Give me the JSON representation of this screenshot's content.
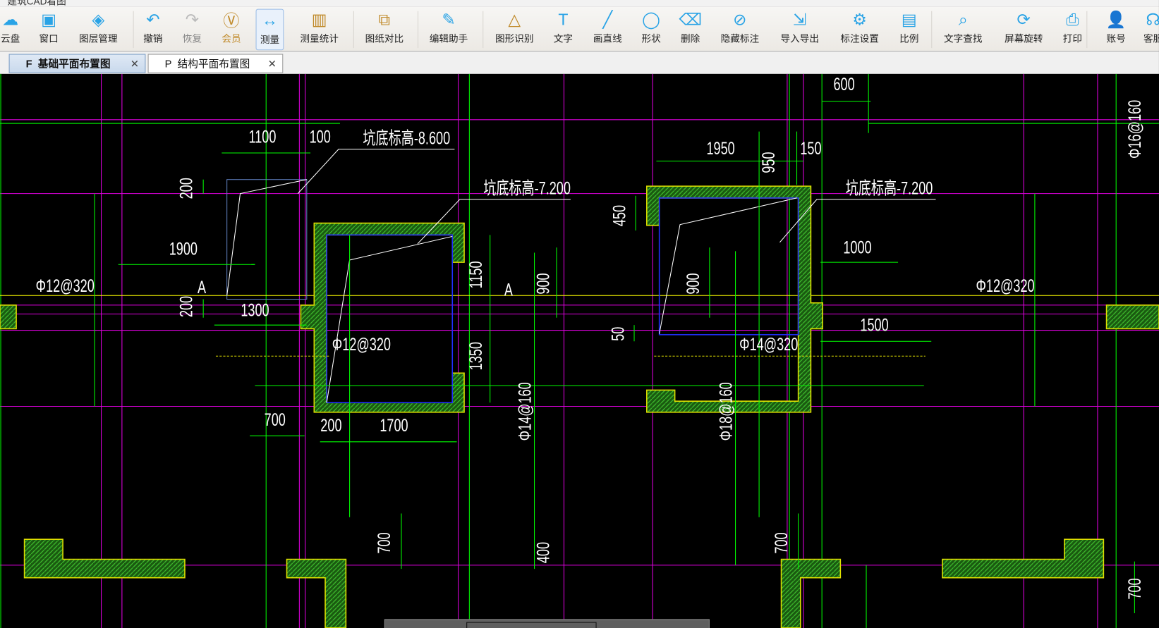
{
  "title": "建筑CAD看图",
  "toolbar": {
    "items": [
      {
        "label": "云盘",
        "icon": "cloud-icon"
      },
      {
        "label": "窗口",
        "icon": "window-icon"
      },
      {
        "label": "图层管理",
        "icon": "layers-icon"
      },
      {
        "label": "撤销",
        "icon": "undo-icon"
      },
      {
        "label": "恢复",
        "icon": "redo-icon"
      },
      {
        "label": "会员",
        "icon": "vip-icon"
      },
      {
        "label": "测量",
        "icon": "measure-icon"
      },
      {
        "label": "测量统计",
        "icon": "measure-stats-icon"
      },
      {
        "label": "图纸对比",
        "icon": "compare-icon"
      },
      {
        "label": "编辑助手",
        "icon": "cad-edit-icon"
      },
      {
        "label": "图形识别",
        "icon": "shape-recognize-icon"
      },
      {
        "label": "文字",
        "icon": "text-icon"
      },
      {
        "label": "画直线",
        "icon": "line-icon"
      },
      {
        "label": "形状",
        "icon": "shape-icon"
      },
      {
        "label": "删除",
        "icon": "eraser-icon"
      },
      {
        "label": "隐藏标注",
        "icon": "hide-icon"
      },
      {
        "label": "导入导出",
        "icon": "import-export-icon"
      },
      {
        "label": "标注设置",
        "icon": "annotation-settings-icon"
      },
      {
        "label": "比例",
        "icon": "scale-icon"
      },
      {
        "label": "文字查找",
        "icon": "text-search-icon"
      },
      {
        "label": "屏幕旋转",
        "icon": "rotate-icon"
      },
      {
        "label": "打印",
        "icon": "print-icon"
      },
      {
        "label": "账号",
        "icon": "account-icon"
      },
      {
        "label": "客服",
        "icon": "support-icon"
      }
    ],
    "active": "测量"
  },
  "tabs": [
    {
      "prefix": "F",
      "label": "基础平面布置图",
      "active": true
    },
    {
      "prefix": "P",
      "label": "结构平面布置图",
      "active": false
    }
  ],
  "colors": {
    "magenta": "#e000e0",
    "green": "#00ff00",
    "yellow": "#ffff00",
    "hatch": "#2f8f1f",
    "blue": "#2030ff"
  },
  "drawing": {
    "labels": [
      "600",
      "1100",
      "100",
      "坑底标高-8.600",
      "200",
      "1900",
      "Φ12@320",
      "A",
      "200",
      "1300",
      "坑底标高-7.200",
      "1150",
      "A",
      "900",
      "Φ12@320",
      "1350",
      "700",
      "200",
      "1700",
      "Φ14@160",
      "700",
      "400",
      "1950",
      "950",
      "150",
      "坑底标高-7.200",
      "450",
      "1000",
      "900",
      "Φ12@320",
      "50",
      "Φ14@320",
      "1500",
      "Φ18@160",
      "700",
      "700",
      "Φ16@160"
    ]
  }
}
